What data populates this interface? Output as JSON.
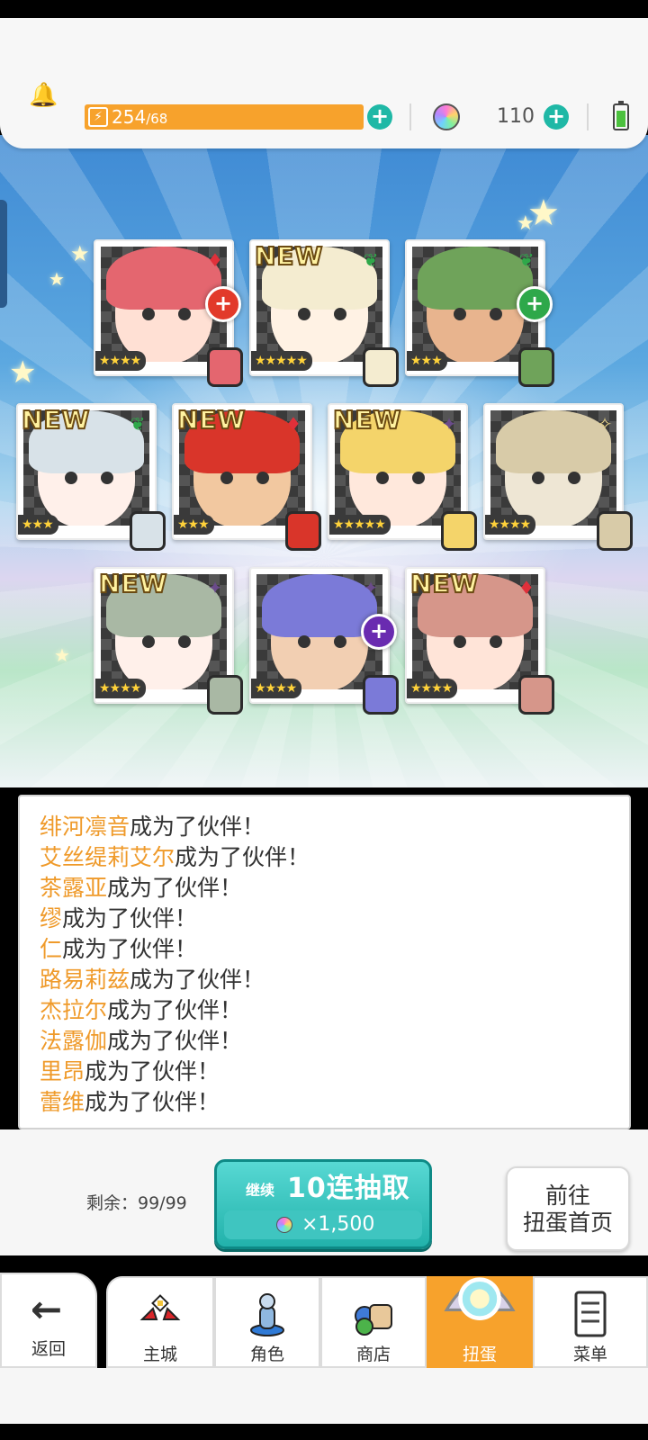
{
  "header": {
    "stamina_current": "254",
    "stamina_max": "/68",
    "gems": "110"
  },
  "cards": [
    {
      "id": "c1",
      "stars": "★★★★",
      "is_new": false,
      "attr_icon": "fire-diamond-icon",
      "attr_color": "#e0303a",
      "hair": "#e4666f",
      "skin": "#ffe0d4",
      "orb": "fire-orb-icon",
      "orb_color": "#e23a2a"
    },
    {
      "id": "c2",
      "stars": "★★★★★",
      "is_new": true,
      "attr_icon": "leaf-icon",
      "attr_color": "#2fa84a",
      "hair": "#f4ecd0",
      "skin": "#fff2e4",
      "orb": "",
      "orb_color": ""
    },
    {
      "id": "c3",
      "stars": "★★★",
      "is_new": false,
      "attr_icon": "leaf-icon",
      "attr_color": "#2fa84a",
      "hair": "#6fa35a",
      "skin": "#e8b48e",
      "orb": "wind-orb-icon",
      "orb_color": "#2ea84a"
    },
    {
      "id": "c4",
      "stars": "★★★",
      "is_new": true,
      "attr_icon": "leaf-icon",
      "attr_color": "#2fa84a",
      "hair": "#d8e2e8",
      "skin": "#fff0ea",
      "orb": "",
      "orb_color": ""
    },
    {
      "id": "c5",
      "stars": "★★★",
      "is_new": true,
      "attr_icon": "fire-diamond-icon",
      "attr_color": "#e0303a",
      "hair": "#d9352a",
      "skin": "#f2c8a0",
      "orb": "",
      "orb_color": ""
    },
    {
      "id": "c6",
      "stars": "★★★★★",
      "is_new": true,
      "attr_icon": "dark-star-icon",
      "attr_color": "#6a4b8a",
      "hair": "#f4d46a",
      "skin": "#ffe8dc",
      "orb": "",
      "orb_color": ""
    },
    {
      "id": "c7",
      "stars": "★★★★",
      "is_new": false,
      "attr_icon": "light-star-icon",
      "attr_color": "#e8d48a",
      "hair": "#d8cba8",
      "skin": "#eee6d4",
      "orb": "",
      "orb_color": ""
    },
    {
      "id": "c8",
      "stars": "★★★★",
      "is_new": true,
      "attr_icon": "dark-star-icon",
      "attr_color": "#6a4b8a",
      "hair": "#a9b8a4",
      "skin": "#fff0ea",
      "orb": "",
      "orb_color": ""
    },
    {
      "id": "c9",
      "stars": "★★★★",
      "is_new": false,
      "attr_icon": "dark-star-icon",
      "attr_color": "#6a4b8a",
      "hair": "#7b7ad8",
      "skin": "#f2cfb2",
      "orb": "dark-orb-icon",
      "orb_color": "#6a2bb0"
    },
    {
      "id": "c10",
      "stars": "★★★★",
      "is_new": true,
      "attr_icon": "fire-diamond-icon",
      "attr_color": "#e0303a",
      "hair": "#d6968a",
      "skin": "#ffe4d8",
      "orb": "",
      "orb_color": ""
    }
  ],
  "new_label": "NEW",
  "log": [
    {
      "name": "绯河凛音",
      "suffix": "成为了伙伴！"
    },
    {
      "name": "艾丝缇莉艾尔",
      "suffix": "成为了伙伴！"
    },
    {
      "name": "茶露亚",
      "suffix": "成为了伙伴！"
    },
    {
      "name": "缪",
      "suffix": "成为了伙伴！"
    },
    {
      "name": "仁",
      "suffix": "成为了伙伴！"
    },
    {
      "name": "路易莉兹",
      "suffix": "成为了伙伴！"
    },
    {
      "name": "杰拉尔",
      "suffix": "成为了伙伴！"
    },
    {
      "name": "法露伽",
      "suffix": "成为了伙伴！"
    },
    {
      "name": "里昂",
      "suffix": "成为了伙伴！"
    },
    {
      "name": "蕾维",
      "suffix": "成为了伙伴！"
    }
  ],
  "remaining": "剩余：99/99",
  "pull_button": {
    "prefix": "继续",
    "label": "10连抽取",
    "cost": "×1,500"
  },
  "goto_button": {
    "line1": "前往",
    "line2": "扭蛋首页"
  },
  "nav": {
    "back": "返回",
    "tabs": [
      {
        "label": "主城",
        "icon": "castle-icon"
      },
      {
        "label": "角色",
        "icon": "character-statue-icon"
      },
      {
        "label": "商店",
        "icon": "shop-bag-icon"
      },
      {
        "label": "扭蛋",
        "icon": "gacha-crystal-icon",
        "active": true
      },
      {
        "label": "菜单",
        "icon": "menu-list-icon"
      }
    ]
  },
  "colors": {
    "accent": "#f7a22c",
    "teal": "#1fb8a6",
    "name_orange": "#ef9a2a"
  }
}
